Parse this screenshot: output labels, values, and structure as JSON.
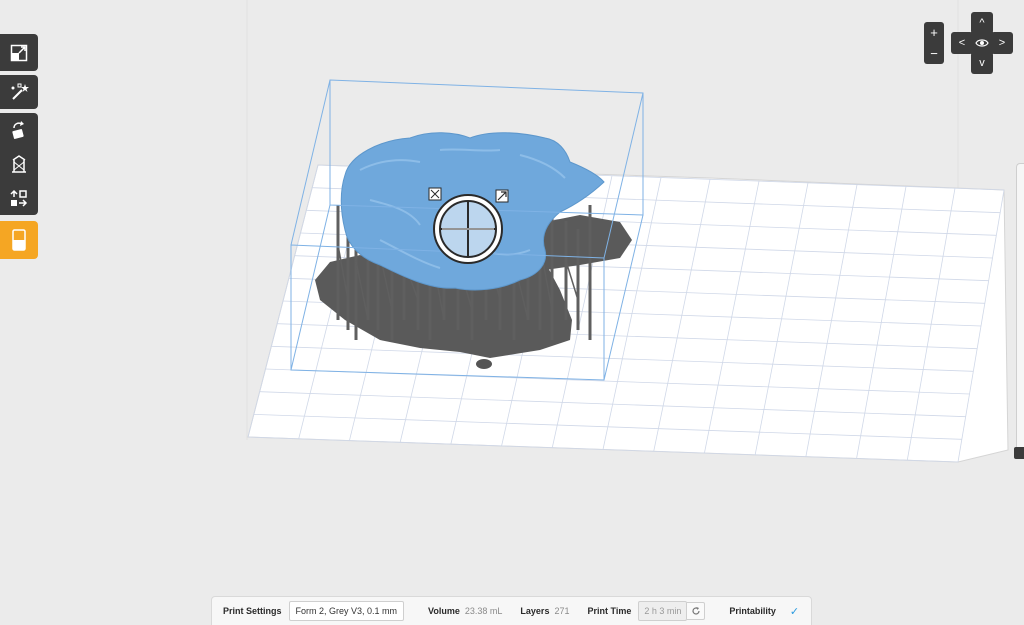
{
  "toolbar": {
    "tools": [
      {
        "name": "scale",
        "icon": "scale-icon"
      },
      {
        "name": "magic-wand",
        "icon": "magic-wand-icon"
      },
      {
        "name": "orientation",
        "icon": "rotate-icon"
      },
      {
        "name": "supports",
        "icon": "supports-icon"
      },
      {
        "name": "layout",
        "icon": "layout-icon"
      },
      {
        "name": "print",
        "icon": "print-icon"
      }
    ],
    "accent_color": "#f5a623"
  },
  "view_controls": {
    "zoom_in": "+",
    "zoom_out": "−",
    "up": "^",
    "down": "v",
    "left": "<",
    "right": ">",
    "center_icon": "eye-icon"
  },
  "scene": {
    "model_color": "#6fa8dc",
    "support_color": "#5f5f5f",
    "platform_color": "#ffffff",
    "grid_color": "#d0d8e8",
    "bbox_color": "#7fb2e5"
  },
  "statusbar": {
    "print_settings_label": "Print Settings",
    "print_settings_value": "Form 2, Grey V3, 0.1 mm",
    "volume_label": "Volume",
    "volume_value": "23.38 mL",
    "layers_label": "Layers",
    "layers_value": "271",
    "print_time_label": "Print Time",
    "print_time_value": "2 h 3 min",
    "printability_label": "Printability",
    "printability_icon": "checkmark-icon"
  }
}
